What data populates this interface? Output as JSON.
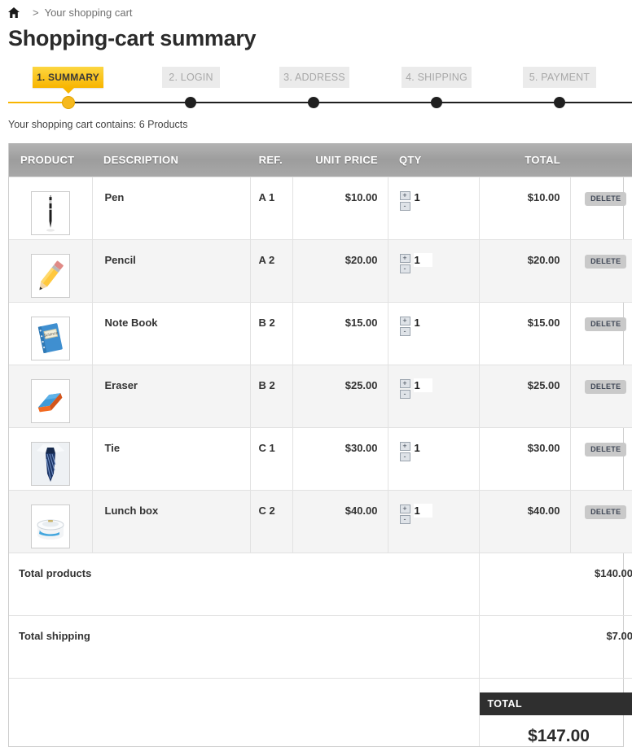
{
  "breadcrumb": {
    "home_icon": "home-icon",
    "separator": ">",
    "current": "Your shopping cart"
  },
  "page_title": "Shopping-cart summary",
  "stepper": {
    "steps": [
      {
        "label": "1. SUMMARY",
        "state": "active"
      },
      {
        "label": "2. LOGIN",
        "state": "inactive"
      },
      {
        "label": "3. ADDRESS",
        "state": "inactive"
      },
      {
        "label": "4. SHIPPING",
        "state": "inactive"
      },
      {
        "label": "5. PAYMENT",
        "state": "inactive"
      }
    ],
    "active_color": "#f8b500",
    "track_color": "#1f1f1f"
  },
  "cart_count_text": "Your shopping cart contains: 6 Products",
  "table": {
    "headers": {
      "product": "PRODUCT",
      "description": "DESCRIPTION",
      "ref": "REF.",
      "unit_price": "UNIT PRICE",
      "qty": "QTY",
      "total": "TOTAL",
      "actions": ""
    },
    "rows": [
      {
        "image": "pen",
        "description": "Pen",
        "ref": "A 1",
        "unit_price": "$10.00",
        "qty": "1",
        "total": "$10.00",
        "delete_label": "DELETE"
      },
      {
        "image": "pencil",
        "description": "Pencil",
        "ref": "A 2",
        "unit_price": "$20.00",
        "qty": "1",
        "total": "$20.00",
        "delete_label": "DELETE"
      },
      {
        "image": "notebook",
        "description": "Note Book",
        "ref": "B 2",
        "unit_price": "$15.00",
        "qty": "1",
        "total": "$15.00",
        "delete_label": "DELETE"
      },
      {
        "image": "eraser",
        "description": "Eraser",
        "ref": "B 2",
        "unit_price": "$25.00",
        "qty": "1",
        "total": "$25.00",
        "delete_label": "DELETE"
      },
      {
        "image": "tie",
        "description": "Tie",
        "ref": "C 1",
        "unit_price": "$30.00",
        "qty": "1",
        "total": "$30.00",
        "delete_label": "DELETE"
      },
      {
        "image": "lunchbox",
        "description": "Lunch box",
        "ref": "C 2",
        "unit_price": "$40.00",
        "qty": "1",
        "total": "$40.00",
        "delete_label": "DELETE"
      }
    ],
    "stepper_controls": {
      "increase": "+",
      "decrease": "-"
    }
  },
  "totals": {
    "products_label": "Total products",
    "products_value": "$140.00",
    "shipping_label": "Total shipping",
    "shipping_value": "$7.00",
    "grand_label": "TOTAL",
    "grand_value": "$147.00",
    "grand_bar_color": "#2f2f2f"
  }
}
